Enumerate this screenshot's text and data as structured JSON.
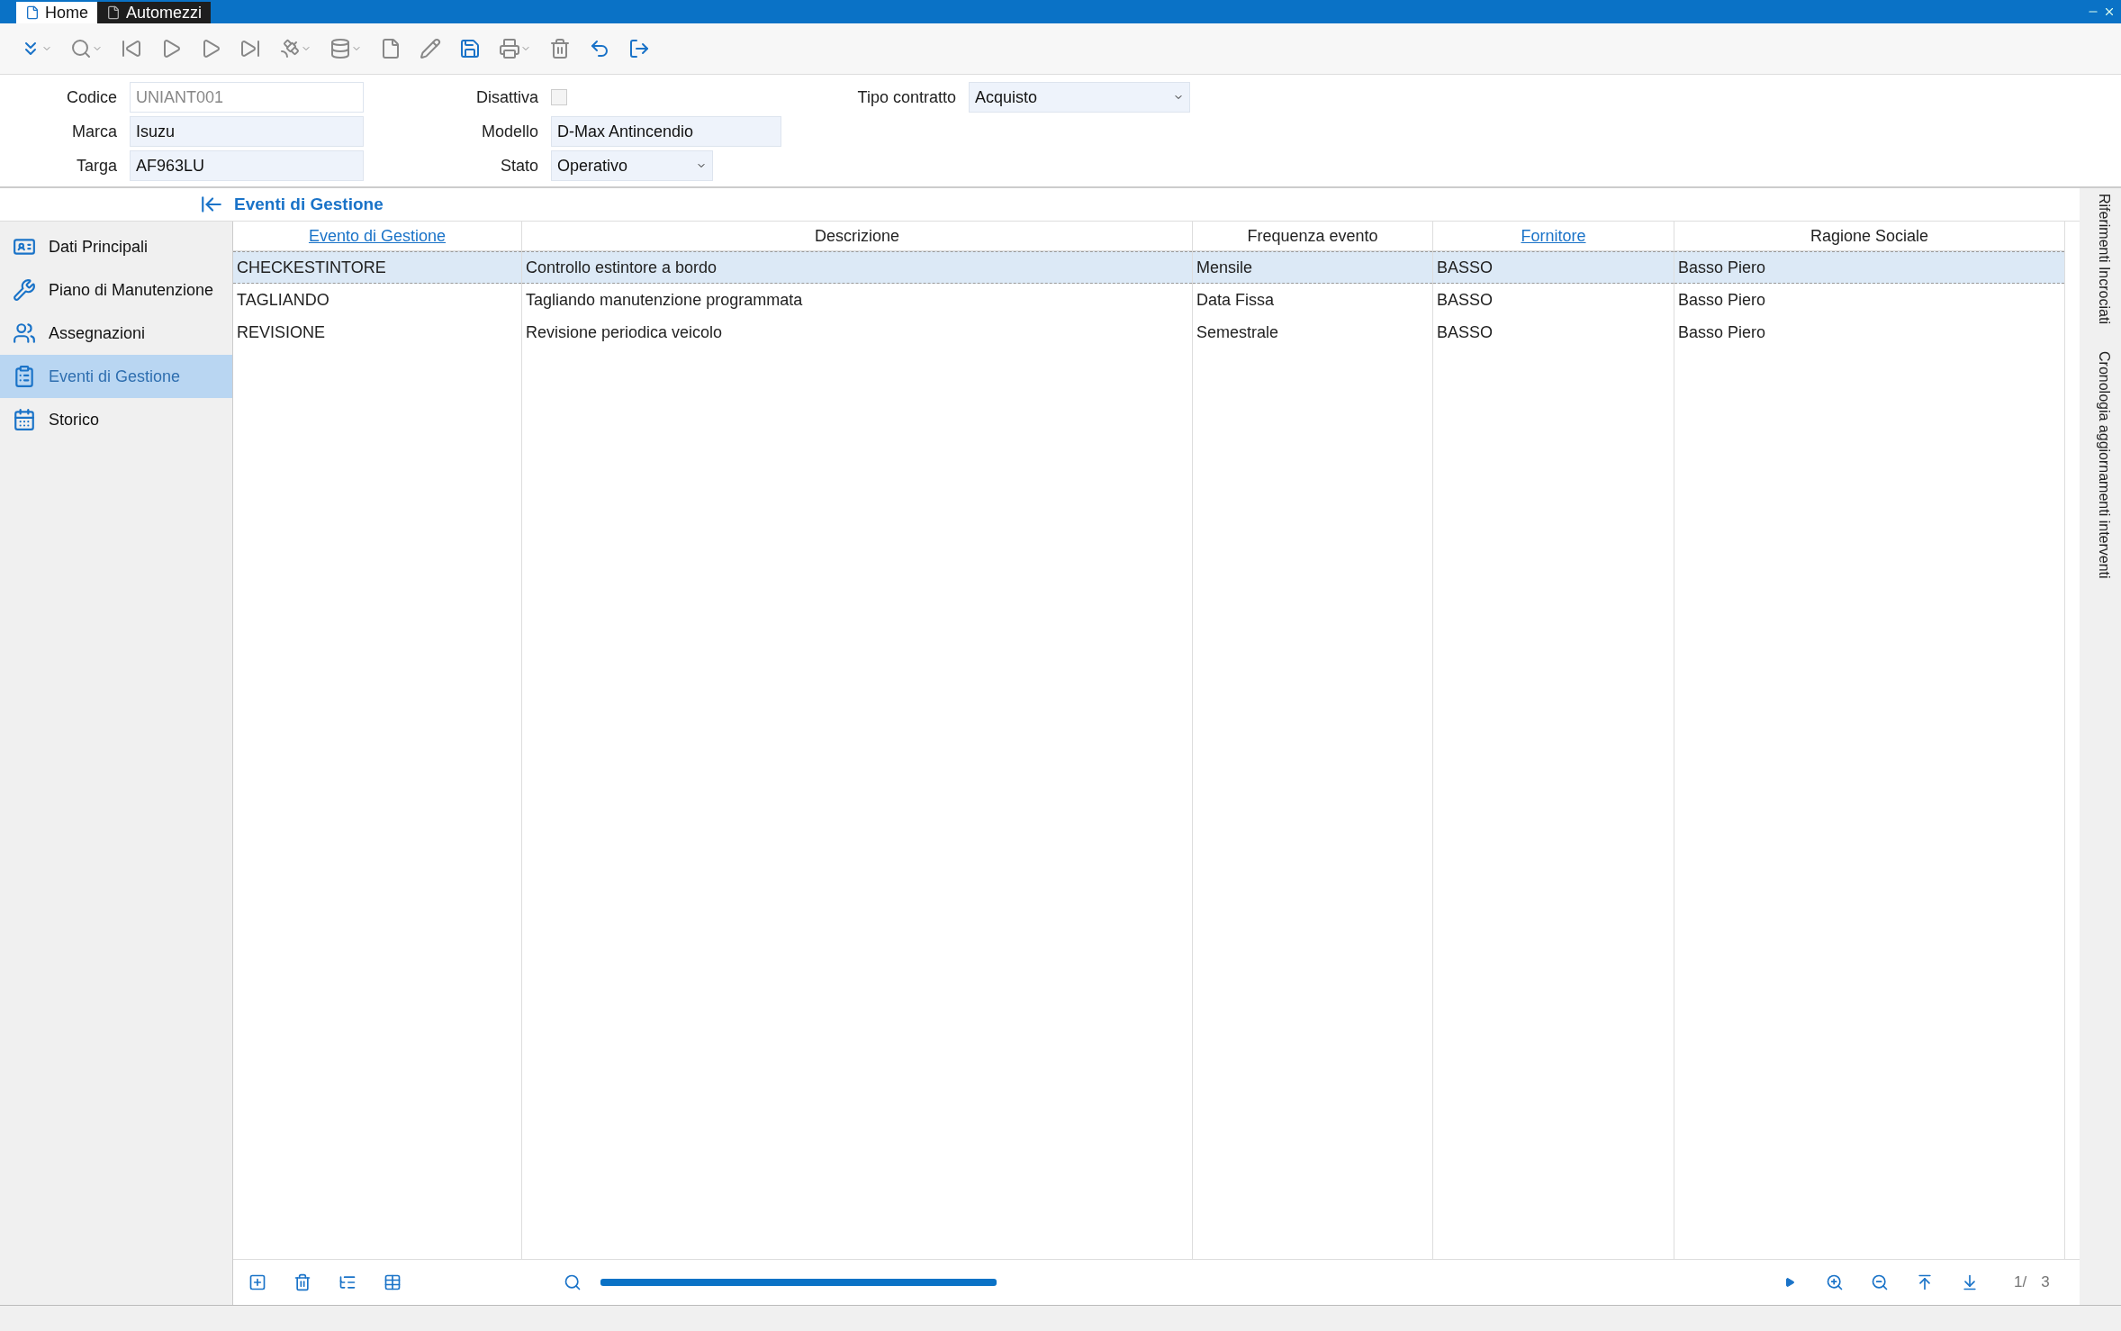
{
  "window_tabs": [
    {
      "label": "Home",
      "selected": true
    },
    {
      "label": "Automezzi",
      "selected": false
    }
  ],
  "form": {
    "codice": {
      "label": "Codice",
      "value": "UNIANT001",
      "disabled": true
    },
    "disattiva": {
      "label": "Disattiva",
      "checked": false
    },
    "tipo_contratto": {
      "label": "Tipo contratto",
      "value": "Acquisto"
    },
    "marca": {
      "label": "Marca",
      "value": "Isuzu"
    },
    "modello": {
      "label": "Modello",
      "value": "D-Max Antincendio"
    },
    "targa": {
      "label": "Targa",
      "value": "AF963LU"
    },
    "stato": {
      "label": "Stato",
      "value": "Operativo"
    }
  },
  "section_title": "Eventi di Gestione",
  "sidebar": {
    "items": [
      {
        "label": "Dati Principali",
        "selected": false
      },
      {
        "label": "Piano di Manutenzione",
        "selected": false
      },
      {
        "label": "Assegnazioni",
        "selected": false
      },
      {
        "label": "Eventi di Gestione",
        "selected": true
      },
      {
        "label": "Storico",
        "selected": false
      }
    ]
  },
  "table": {
    "columns": [
      {
        "label": "Evento di Gestione",
        "link": true
      },
      {
        "label": "Descrizione",
        "link": false
      },
      {
        "label": "Frequenza evento",
        "link": false
      },
      {
        "label": "Fornitore",
        "link": true
      },
      {
        "label": "Ragione Sociale",
        "link": false
      }
    ],
    "rows": [
      {
        "cells": [
          "CHECKESTINTORE",
          "Controllo estintore a bordo",
          "Mensile",
          "BASSO",
          "Basso Piero"
        ],
        "selected": true
      },
      {
        "cells": [
          "TAGLIANDO",
          "Tagliando manutenzione programmata",
          "Data Fissa",
          "BASSO",
          "Basso Piero"
        ],
        "selected": false
      },
      {
        "cells": [
          "REVISIONE",
          "Revisione periodica veicolo",
          "Semestrale",
          "BASSO",
          "Basso Piero"
        ],
        "selected": false
      }
    ]
  },
  "pager": {
    "current": "1/",
    "total": "3"
  },
  "side_tabs": [
    "Riferimenti Incrociati",
    "Cronologia aggiornamenti interventi"
  ]
}
